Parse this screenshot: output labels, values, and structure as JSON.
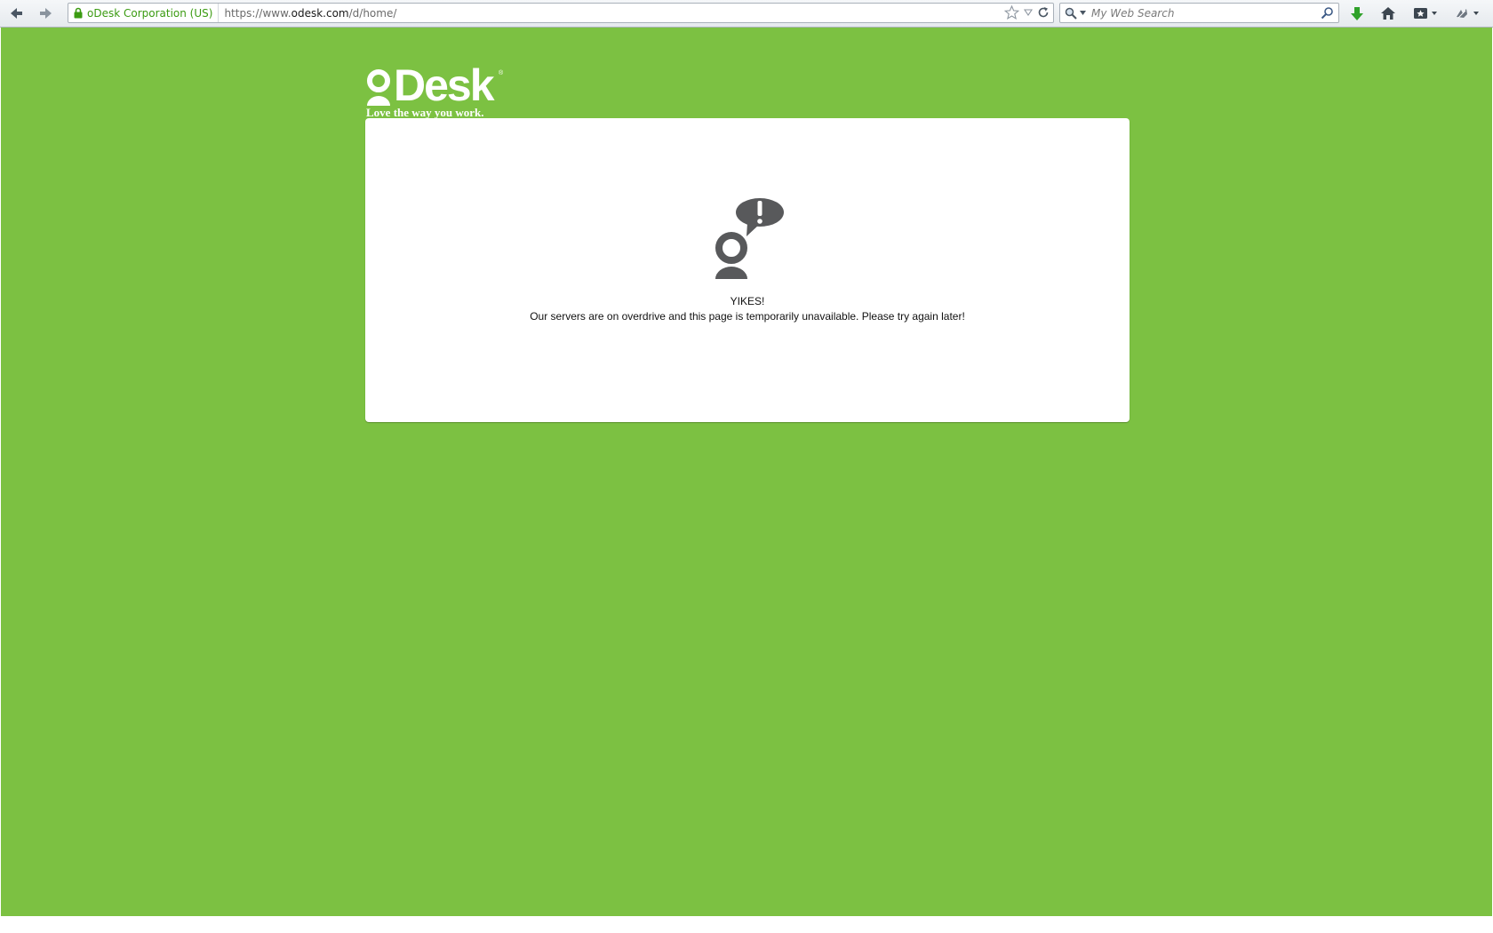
{
  "browser": {
    "identity_label": "oDesk Corporation (US)",
    "url_prefix": "https://www.",
    "url_host": "odesk.com",
    "url_path": "/d/home/",
    "search_placeholder": "My Web Search",
    "icons": {
      "back": "back-arrow-icon",
      "forward": "forward-arrow-icon",
      "secure": "lock-icon",
      "bookmark": "star-icon",
      "history": "dropdown-triangle-icon",
      "reload": "reload-icon",
      "search_engine": "magnifier-icon",
      "search_go": "search-go-icon",
      "downloads": "download-arrow-icon",
      "home": "home-icon",
      "bookmarks_menu": "bookmarks-menu-icon",
      "addon": "addon-icon"
    },
    "colors": {
      "identity_green": "#3b9b12",
      "download_green": "#2fa12a"
    }
  },
  "page": {
    "background_color": "#7cc142",
    "logo": {
      "name": "oDesk",
      "registered": "®",
      "tagline": "Love the way you work."
    },
    "error": {
      "illustration": "person-exclamation-speech-bubble-icon",
      "title": "YIKES!",
      "message": "Our servers are on overdrive and this page is temporarily unavailable. Please try again later!"
    }
  }
}
